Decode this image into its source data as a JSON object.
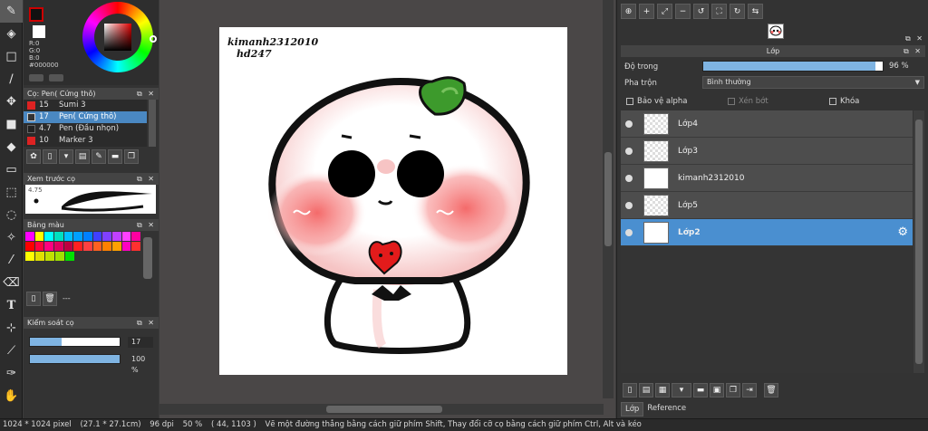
{
  "left_panel": {
    "color": {
      "r_text": "R:0",
      "g_text": "G:0",
      "b_text": "B:0",
      "hex": "#000000",
      "fg_color": "#000000"
    },
    "brush_header": "Cọ: Pen( Cứng thô)",
    "brushes": [
      {
        "size": "15",
        "name": "Sumi 3",
        "color": "#d22"
      },
      {
        "size": "17",
        "name": "Pen( Cứng thô)",
        "color": "#333"
      },
      {
        "size": "4.7",
        "name": "Pen (Đầu nhọn)",
        "color": "#222"
      },
      {
        "size": "10",
        "name": "Marker 3",
        "color": "#d22"
      }
    ],
    "preview_header": "Xem trước cọ",
    "preview_size": "4.75",
    "palette_header": "Bảng màu",
    "palette_rows": [
      [
        "#ff00ff",
        "#ffff00",
        "#00ffff",
        "#00e0c0",
        "#00c0ff",
        "#00a0ff",
        "#0080ff",
        "#4040ff",
        "#8040ff",
        "#c040ff",
        "#ff40ff",
        "#ff00a0"
      ],
      [
        "#ff0000",
        "#ff0040",
        "#ff0080",
        "#e00060",
        "#c00040",
        "#ff2020",
        "#ff4040",
        "#ff6020",
        "#ff8000",
        "#ffa000",
        "#ff00c0",
        "#ff3030"
      ],
      [
        "#ffff00",
        "#e0e000",
        "#c0e000",
        "#a0e000",
        "#00e000"
      ]
    ],
    "palette_footer": "---",
    "brush_control_header": "Kiểm soát cọ",
    "brush_size": "17",
    "brush_size_fraction": 0.35,
    "brush_opacity": "100 %",
    "brush_opacity_fraction": 1.0
  },
  "canvas": {
    "artist_line1": "kimanh2312010",
    "artist_line2": "hd247"
  },
  "right_panel": {
    "layer_header": "Lớp",
    "opacity_label": "Độ trong",
    "opacity_value": "96 %",
    "opacity_fraction": 0.96,
    "blend_label": "Pha trộn",
    "blend_value": "Bình thường",
    "protect_alpha": "Bảo vệ alpha",
    "clipping": "Xén bớt",
    "lock": "Khóa",
    "layers": [
      {
        "name": "Lớp4",
        "selected": false
      },
      {
        "name": "Lớp3",
        "selected": false
      },
      {
        "name": "kimanh2312010",
        "selected": false
      },
      {
        "name": "Lớp5",
        "selected": false
      },
      {
        "name": "Lớp2",
        "selected": true
      }
    ],
    "tabs": [
      "Lớp",
      "Reference"
    ]
  },
  "status": {
    "canvas_size": "1024 * 1024 pixel",
    "physical_size": "(27.1 * 27.1cm)",
    "dpi": "96 dpi",
    "zoom": "50 %",
    "cursor": "( 44, 1103 )",
    "hint": "Vẽ một đường thẳng bằng cách giữ phím Shift, Thay đổi cỡ cọ bằng cách giữ phím Ctrl, Alt và kéo"
  }
}
